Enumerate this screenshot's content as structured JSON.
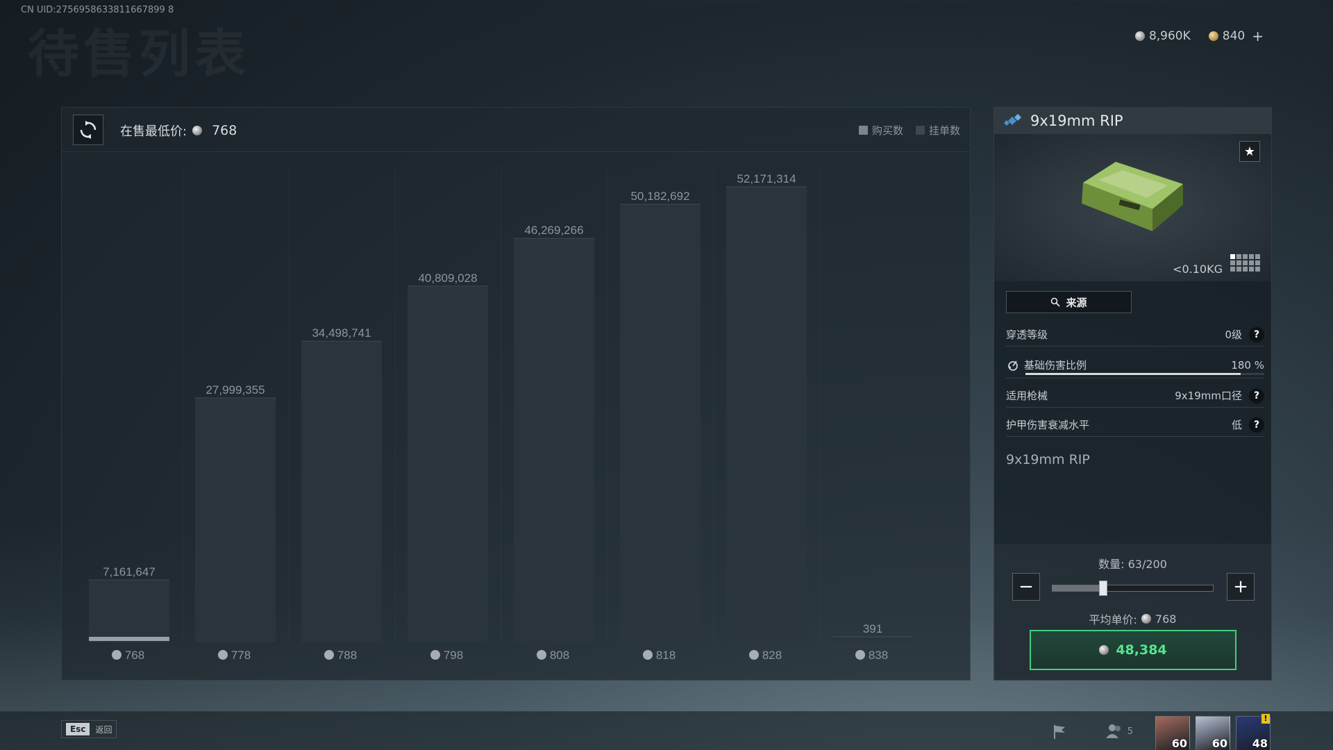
{
  "uid": "CN UID:2756958633811667899 8",
  "bg_title": "待售列表",
  "currency": {
    "silver": "8,960K",
    "gold": "840"
  },
  "chart": {
    "min_price_label": "在售最低价:",
    "min_price_value": "768",
    "legend": [
      {
        "label": "购买数",
        "color": "#7d858b"
      },
      {
        "label": "挂单数",
        "color": "#3c474f"
      }
    ]
  },
  "chart_data": {
    "type": "bar",
    "categories": [
      "768",
      "778",
      "788",
      "798",
      "808",
      "818",
      "828",
      "838"
    ],
    "series": [
      {
        "name": "挂单数",
        "values": [
          7161647,
          27999355,
          34498741,
          40809028,
          46269266,
          50182692,
          52171314,
          391
        ]
      }
    ],
    "labels": [
      "7,161,647",
      "27,999,355",
      "34,498,741",
      "40,809,028",
      "46,269,266",
      "50,182,692",
      "52,171,314",
      "391"
    ],
    "ylim": [
      0,
      52171314
    ]
  },
  "item": {
    "name": "9x19mm RIP",
    "weight": "<0.10KG",
    "source_label": "来源",
    "attributes": [
      {
        "label": "穿透等级",
        "value": "0级",
        "help": "?"
      },
      {
        "label": "基础伤害比例",
        "value": "180 %",
        "bar": 0.9
      },
      {
        "label": "适用枪械",
        "value": "9x19mm口径",
        "help": "?"
      },
      {
        "label": "护甲伤害衰减水平",
        "value": "低",
        "help": "?"
      }
    ],
    "description": "9x19mm RIP"
  },
  "purchase": {
    "qty_label": "数量: 63/200",
    "quantity": 63,
    "max": 200,
    "avg_label": "平均单价:",
    "avg_value": "768",
    "total": "48,384"
  },
  "bottom": {
    "esc_key": "Esc",
    "esc_label": "返回",
    "friends": "5",
    "avatars": [
      {
        "level": "60",
        "color": "#a46a5c"
      },
      {
        "level": "60",
        "color": "#b8c0d4"
      },
      {
        "level": "48",
        "color": "#2a3a78",
        "alert": "!"
      }
    ]
  },
  "colors": {
    "accent_green": "#3fd17a",
    "bar_fill": "#2b353c"
  }
}
